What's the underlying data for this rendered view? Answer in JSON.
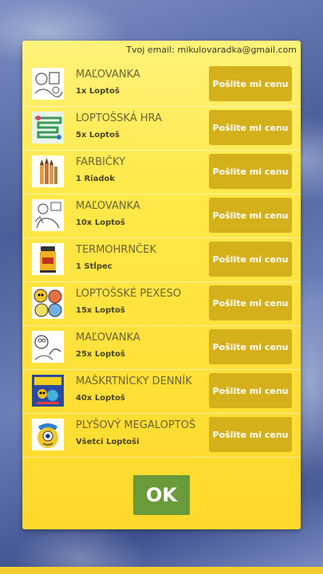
{
  "email_label": "Tvoj email: mikulovaradka@gmail.com",
  "items": [
    {
      "title": "MAĽOVANKA",
      "qty": "1x Loptoš",
      "button": "Pošlite mi cenu",
      "icon": "coloring-page-icon"
    },
    {
      "title": "LOPTOŠSKÁ HRA",
      "qty": "5x Loptoš",
      "button": "Pošlite mi cenu",
      "icon": "board-game-icon"
    },
    {
      "title": "FARBIČKY",
      "qty": "1 Riadok",
      "button": "Pošlite mi cenu",
      "icon": "crayons-icon"
    },
    {
      "title": "MAĽOVANKA",
      "qty": "10x Loptoš",
      "button": "Pošlite mi cenu",
      "icon": "coloring-page-icon"
    },
    {
      "title": "TERMOHRNČEK",
      "qty": "1 Stĺpec",
      "button": "Pošlite mi cenu",
      "icon": "thermo-mug-icon"
    },
    {
      "title": "LOPTOŠSKÉ PEXESO",
      "qty": "15x Loptoš",
      "button": "Pošlite mi cenu",
      "icon": "memory-cards-icon"
    },
    {
      "title": "MAĽOVANKA",
      "qty": "25x Loptoš",
      "button": "Pošlite mi cenu",
      "icon": "coloring-page-icon"
    },
    {
      "title": "MAŠKRTNÍCKY DENNÍK",
      "qty": "40x Loptoš",
      "button": "Pošlite mi cenu",
      "icon": "diary-book-icon"
    },
    {
      "title": "PLYŠOVÝ MEGALOPTOŠ",
      "qty": "Všetci Loptoši",
      "button": "Pošlite mi cenu",
      "icon": "plush-toy-icon"
    }
  ],
  "ok_label": "OK",
  "colors": {
    "panel": "#ffe94a",
    "button": "#d4b01b",
    "ok_button": "#6a9a3a",
    "background": "#5a6fa3"
  }
}
